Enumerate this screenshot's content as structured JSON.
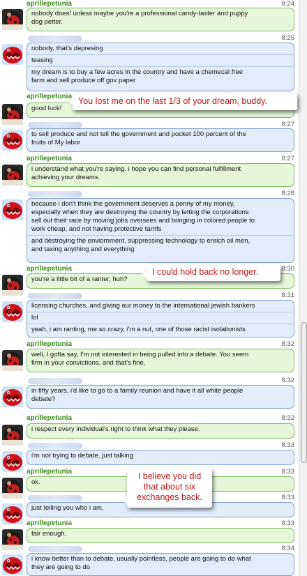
{
  "colors": {
    "self_name": "#3d8a1d",
    "callout_text": "#c0151b",
    "self_bubble": "#e6f7d9",
    "other_bubble": "#e2ecfa"
  },
  "icons": {
    "self_avatar": "red-ladybug-avatar-icon",
    "other_avatar": "red-creature-avatar-icon"
  },
  "messages": [
    {
      "sender": "aprillepetunia",
      "time": "8:24",
      "lines": [
        [
          "nobody does! unless maybe you're a professional candy-taster and puppy",
          "dog petter."
        ]
      ]
    },
    {
      "sender": "",
      "time": "8:25",
      "lines": [
        [
          "nobody, that's depresing"
        ],
        [
          "teasing"
        ],
        [
          "my dream is to buy a few acres in the country and have a chemecal free",
          "farm and sell produce off gov paper"
        ]
      ]
    },
    {
      "sender": "aprillepetunia",
      "time": "",
      "lines": [
        [
          "good luck!"
        ]
      ]
    },
    {
      "sender": "",
      "time": "8:27",
      "lines": [
        [
          "to sell produce and not tell the government and pocket 100 percent of the",
          "fruits of My labor"
        ]
      ]
    },
    {
      "sender": "aprillepetunia",
      "time": "8:27",
      "lines": [
        [
          "i understand what you're saying. i hope you can find personal fulfillment",
          "achieving your dreams."
        ]
      ]
    },
    {
      "sender": "",
      "time": "8:28",
      "lines": [
        [
          "because i don't think the government deserves a penny of my money,",
          "especially when they are destroying the country by letting the corporations",
          "sell out their race by moving jobs oversees and bringing in colored people to",
          "work cheap, and not having protective tarrifs"
        ],
        [
          "and destroying the enviornment, suppressing technology to enrich oil men,",
          "and taxing anything and everything"
        ]
      ]
    },
    {
      "sender": "aprillepetunia",
      "time": "8:30",
      "lines": [
        [
          "you're a little bit of a ranter, huh?"
        ]
      ]
    },
    {
      "sender": "",
      "time": "8:31",
      "lines": [
        [
          "licensing churches, and giving our money to the international jewish bankers"
        ],
        [
          "lol"
        ],
        [
          "yeah, i am ranting, me so crazy, i'm a nut, one of those racist isolationists"
        ]
      ]
    },
    {
      "sender": "aprillepetunia",
      "time": "8:32",
      "lines": [
        [
          "well, I gotta say, I'm not interested in being pulled into a debate. You seem",
          "firm in your convictions, and that's fine."
        ]
      ]
    },
    {
      "sender": "",
      "time": "8:32",
      "lines": [
        [
          "in fifty years, i'd like to go to a family reunion and have it all white people",
          "debate?"
        ]
      ]
    },
    {
      "sender": "aprillepetunia",
      "time": "8:32",
      "lines": [
        [
          "i respect every individual's right to think what they please."
        ]
      ]
    },
    {
      "sender": "",
      "time": "8:33",
      "lines": [
        [
          "i'm not trying to debate, just talking"
        ]
      ]
    },
    {
      "sender": "aprillepetunia",
      "time": "8:33",
      "lines": [
        [
          "ok."
        ]
      ]
    },
    {
      "sender": "",
      "time": "8:33",
      "lines": [
        [
          "just telling you who i am,"
        ]
      ]
    },
    {
      "sender": "aprillepetunia",
      "time": "8:33",
      "lines": [
        [
          "fair enough."
        ]
      ]
    },
    {
      "sender": "",
      "time": "8:34",
      "lines": [
        [
          "i know better than to debate, usually pointless, people are going to do what",
          "they are going to do"
        ]
      ]
    }
  ],
  "callouts": [
    {
      "text": "You lost me on the last 1/3 of your dream, buddy."
    },
    {
      "text": "I could hold back no longer."
    },
    {
      "text": "I believe you did that about six exchanges back."
    }
  ]
}
